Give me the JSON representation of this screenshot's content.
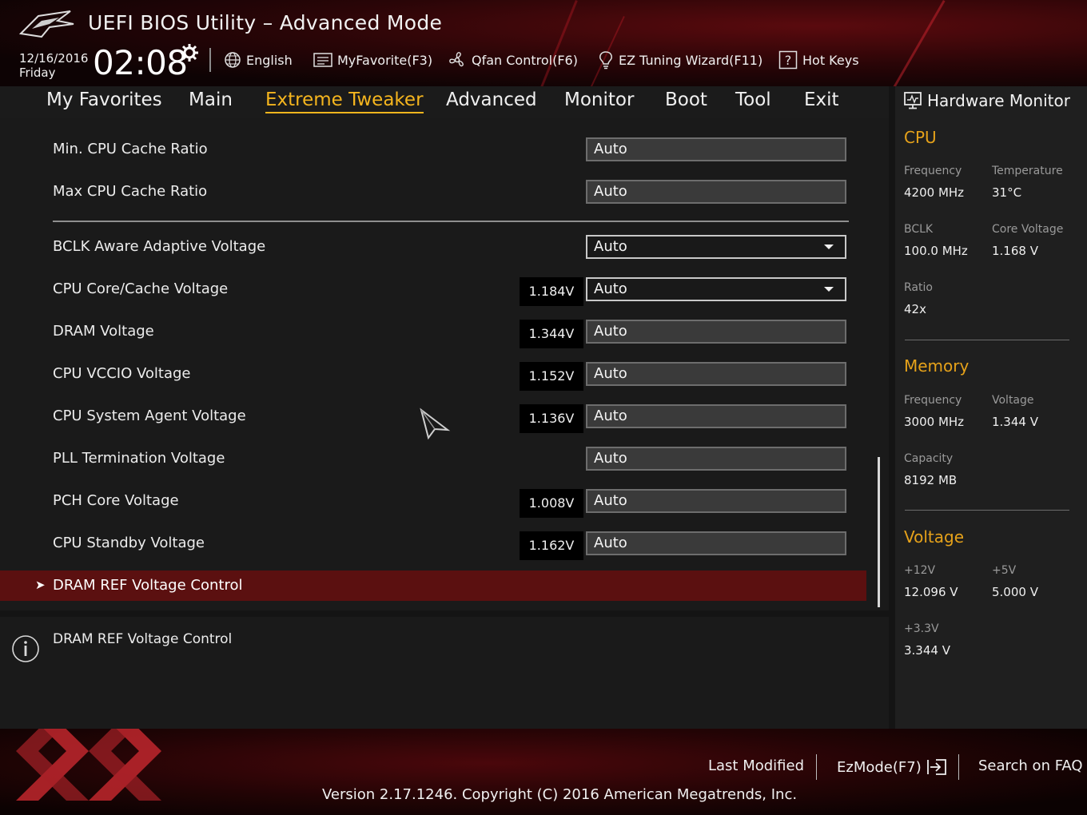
{
  "header": {
    "title": "UEFI BIOS Utility – Advanced Mode",
    "date": "12/16/2016",
    "day": "Friday",
    "time": "02:08",
    "buttons": {
      "language": "English",
      "my_favorite": "MyFavorite(F3)",
      "qfan": "Qfan Control(F6)",
      "ez_tuning": "EZ Tuning Wizard(F11)",
      "hot_keys": "Hot Keys"
    }
  },
  "menu": {
    "tabs": [
      "My Favorites",
      "Main",
      "Extreme Tweaker",
      "Advanced",
      "Monitor",
      "Boot",
      "Tool",
      "Exit"
    ],
    "active_tab": "Extreme Tweaker"
  },
  "settings": [
    {
      "label": "Min. CPU Cache Ratio",
      "readout": "",
      "value": "Auto",
      "dropdown": false
    },
    {
      "label": "Max CPU Cache Ratio",
      "readout": "",
      "value": "Auto",
      "dropdown": false
    },
    {
      "label": "BCLK Aware Adaptive Voltage",
      "readout": "",
      "value": "Auto",
      "dropdown": true
    },
    {
      "label": "CPU Core/Cache Voltage",
      "readout": "1.184V",
      "value": "Auto",
      "dropdown": true
    },
    {
      "label": "DRAM Voltage",
      "readout": "1.344V",
      "value": "Auto",
      "dropdown": false
    },
    {
      "label": "CPU VCCIO Voltage",
      "readout": "1.152V",
      "value": "Auto",
      "dropdown": false
    },
    {
      "label": "CPU System Agent Voltage",
      "readout": "1.136V",
      "value": "Auto",
      "dropdown": false
    },
    {
      "label": "PLL Termination Voltage",
      "readout": "",
      "value": "Auto",
      "dropdown": false
    },
    {
      "label": "PCH Core Voltage",
      "readout": "1.008V",
      "value": "Auto",
      "dropdown": false
    },
    {
      "label": "CPU Standby Voltage",
      "readout": "1.162V",
      "value": "Auto",
      "dropdown": false
    }
  ],
  "submenu": {
    "label": "DRAM REF Voltage Control",
    "selected": true
  },
  "help": {
    "text": "DRAM REF Voltage Control"
  },
  "hardware_monitor": {
    "title": "Hardware Monitor",
    "cpu": {
      "heading": "CPU",
      "frequency_label": "Frequency",
      "frequency": "4200 MHz",
      "temperature_label": "Temperature",
      "temperature": "31°C",
      "bclk_label": "BCLK",
      "bclk": "100.0 MHz",
      "core_voltage_label": "Core Voltage",
      "core_voltage": "1.168 V",
      "ratio_label": "Ratio",
      "ratio": "42x"
    },
    "memory": {
      "heading": "Memory",
      "frequency_label": "Frequency",
      "frequency": "3000 MHz",
      "voltage_label": "Voltage",
      "voltage": "1.344 V",
      "capacity_label": "Capacity",
      "capacity": "8192 MB"
    },
    "voltage": {
      "heading": "Voltage",
      "v12_label": "+12V",
      "v12": "12.096 V",
      "v5_label": "+5V",
      "v5": "5.000 V",
      "v33_label": "+3.3V",
      "v33": "3.344 V"
    }
  },
  "footer": {
    "last_modified": "Last Modified",
    "ezmode": "EzMode(F7)",
    "search_faq": "Search on FAQ",
    "version": "Version 2.17.1246. Copyright (C) 2016 American Megatrends, Inc."
  },
  "colors": {
    "accent": "#f5b51e",
    "selection": "#5b1010",
    "section_heading": "#e6a21a"
  }
}
